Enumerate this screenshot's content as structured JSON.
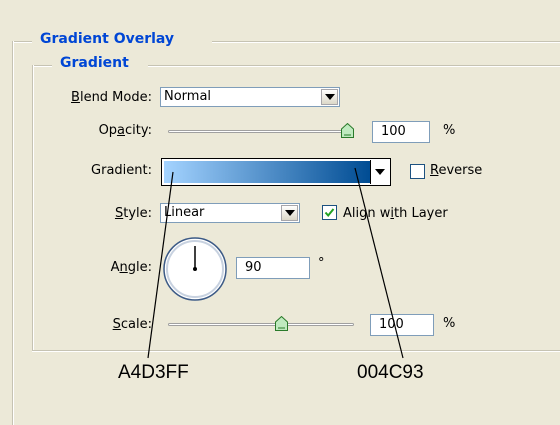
{
  "panel": {
    "outer_title": "Gradient Overlay",
    "inner_title": "Gradient"
  },
  "blend_mode": {
    "label_mnemonic": "B",
    "label_rest": "lend Mode:",
    "value": "Normal"
  },
  "opacity": {
    "label_pre": "Op",
    "label_mnemonic": "a",
    "label_post": "city:",
    "value": "100",
    "unit": "%",
    "fraction": 1.0
  },
  "gradient": {
    "label": "Gradient:",
    "color_start": "#A4D3FF",
    "color_end": "#004C93"
  },
  "reverse": {
    "label_mnemonic": "R",
    "label_rest": "everse",
    "checked": false
  },
  "style": {
    "label_mnemonic": "S",
    "label_rest": "tyle:",
    "value": "Linear"
  },
  "align_with_layer": {
    "label_pre": "Align w",
    "label_mnemonic": "i",
    "label_post": "th Layer",
    "checked": true
  },
  "angle": {
    "label_pre": "A",
    "label_mnemonic": "n",
    "label_post": "gle:",
    "value": "90",
    "unit": "°"
  },
  "scale": {
    "label_mnemonic": "S",
    "label_rest": "cale:",
    "value": "100",
    "unit": "%",
    "fraction": 0.62
  },
  "annotations": {
    "start_hex": "A4D3FF",
    "end_hex": "004C93"
  },
  "colors": {
    "accent": "#0046d5",
    "field_border": "#7f9db9",
    "check_green": "#21a121"
  }
}
